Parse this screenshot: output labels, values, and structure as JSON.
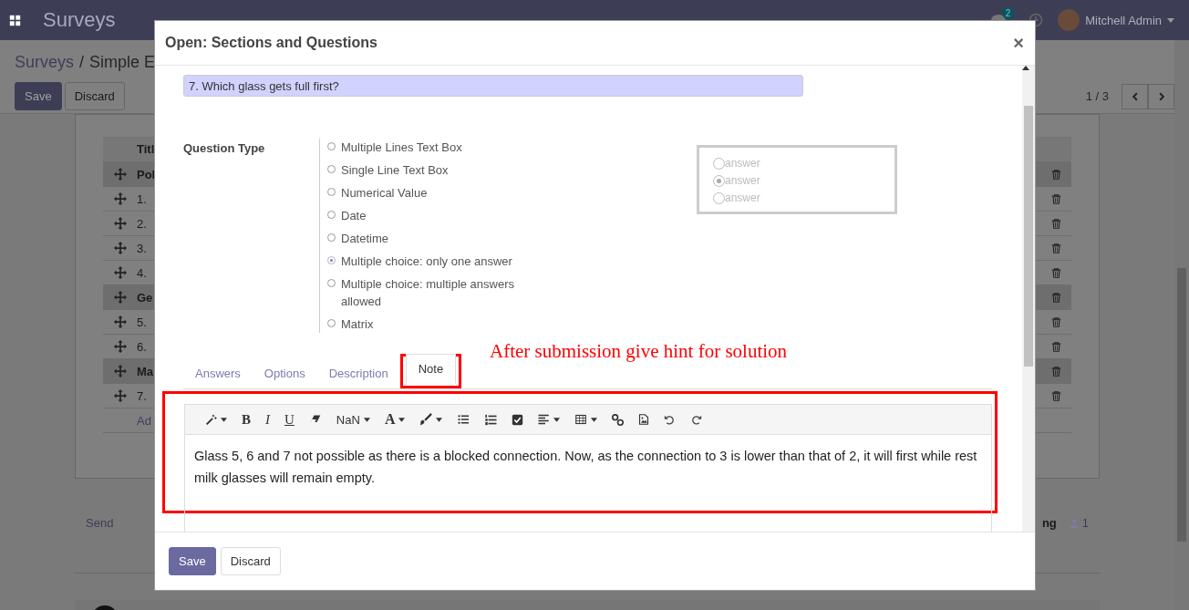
{
  "navbar": {
    "brand": "Surveys",
    "chat_badge": "2",
    "user": "Mitchell Admin"
  },
  "breadcrumb": [
    "Surveys",
    "/",
    "Simple E"
  ],
  "actions": [
    "Save",
    "Discard"
  ],
  "pager": "1 / 3",
  "table": {
    "header": "Titl",
    "rows": [
      {
        "kind": "section",
        "title": "Pol"
      },
      {
        "kind": "question",
        "title": "1."
      },
      {
        "kind": "question",
        "title": "2."
      },
      {
        "kind": "question",
        "title": "3."
      },
      {
        "kind": "question",
        "title": "4."
      },
      {
        "kind": "section",
        "title": "Ge"
      },
      {
        "kind": "question",
        "title": "5."
      },
      {
        "kind": "question",
        "title": "6."
      },
      {
        "kind": "section",
        "title": "Ma"
      },
      {
        "kind": "question",
        "title": "7."
      },
      {
        "kind": "add",
        "title": "Ad"
      }
    ]
  },
  "chatter": {
    "send": "Send",
    "follow": "ng",
    "followers": "1"
  },
  "dialog": {
    "title": "Open: Sections and Questions",
    "close": "×",
    "question": "7. Which glass gets full first?",
    "question_type_label": "Question Type",
    "question_types": [
      {
        "label": "Multiple Lines Text Box",
        "selected": false
      },
      {
        "label": "Single Line Text Box",
        "selected": false
      },
      {
        "label": "Numerical Value",
        "selected": false
      },
      {
        "label": "Date",
        "selected": false
      },
      {
        "label": "Datetime",
        "selected": false
      },
      {
        "label": "Multiple choice: only one answer",
        "selected": true
      },
      {
        "label": "Multiple choice: multiple answers allowed",
        "selected": false
      },
      {
        "label": "Matrix",
        "selected": false
      }
    ],
    "preview": [
      {
        "label": "answer",
        "selected": false
      },
      {
        "label": "answer",
        "selected": true
      },
      {
        "label": "answer",
        "selected": false
      }
    ],
    "annotation": "After submission give hint for solution",
    "tabs": [
      {
        "label": "Answers",
        "selected": false,
        "highlighted": false
      },
      {
        "label": "Options",
        "selected": false,
        "highlighted": false
      },
      {
        "label": "Description",
        "selected": false,
        "highlighted": false
      },
      {
        "label": "Note",
        "selected": true,
        "highlighted": true
      }
    ],
    "toolbar": [
      {
        "kind": "wand",
        "dropdown": true
      },
      {
        "kind": "bold",
        "label": "B",
        "dropdown": false
      },
      {
        "kind": "italic",
        "label": "I",
        "dropdown": false
      },
      {
        "kind": "underline",
        "label": "U",
        "dropdown": false
      },
      {
        "kind": "eraser",
        "dropdown": false
      },
      {
        "kind": "text",
        "label": "NaN",
        "dropdown": true
      },
      {
        "kind": "serif",
        "label": "A",
        "dropdown": true
      },
      {
        "kind": "brush",
        "dropdown": true
      },
      {
        "kind": "ul",
        "dropdown": false
      },
      {
        "kind": "ol",
        "dropdown": false
      },
      {
        "kind": "check",
        "dropdown": false
      },
      {
        "kind": "align",
        "dropdown": true
      },
      {
        "kind": "table",
        "dropdown": true
      },
      {
        "kind": "link",
        "dropdown": false
      },
      {
        "kind": "image",
        "dropdown": false
      },
      {
        "kind": "undo",
        "dropdown": false
      },
      {
        "kind": "redo",
        "dropdown": false
      }
    ],
    "editor_highlighted": true,
    "note": "Glass 5, 6 and 7 not possible as there is a blocked connection. Now, as the connection to 3 is lower than that of 2, it will first while rest milk glasses will remain empty.",
    "buttons": [
      "Save",
      "Discard"
    ]
  }
}
